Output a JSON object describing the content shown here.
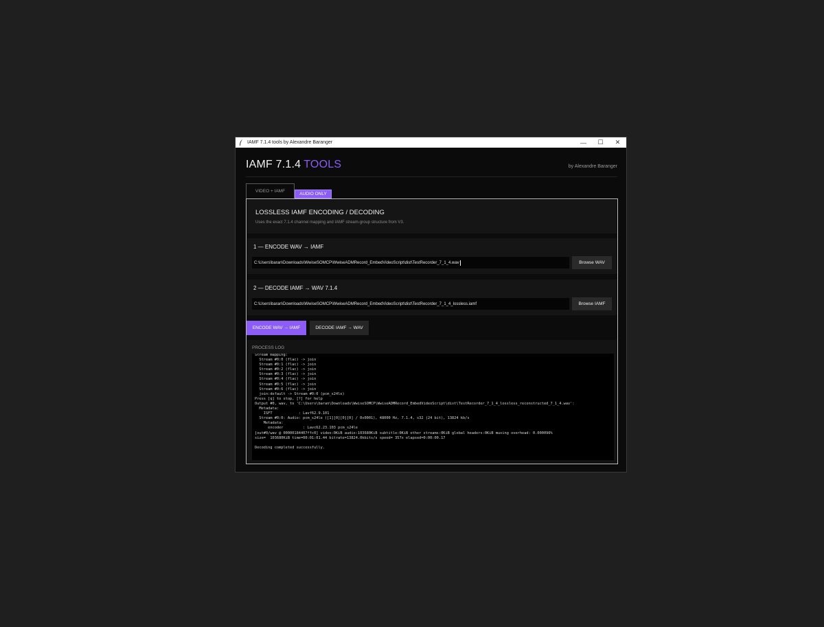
{
  "window": {
    "title": "IAMF 7.1.4 tools by Alexandre Baranger",
    "minimize_glyph": "—",
    "maximize_glyph": "☐",
    "close_glyph": "✕"
  },
  "header": {
    "title_main": "IAMF 7.1.4",
    "title_accent": "TOOLS",
    "author": "by Alexandre Baranger"
  },
  "tabs": {
    "video": "VIDEO + IAMF",
    "audio": "AUDIO ONLY",
    "active": "audio"
  },
  "intro": {
    "title": "LOSSLESS IAMF ENCODING / DECODING",
    "description": "Uses the exact 7.1.4 channel mapping and IAMF stream-group structure from V3."
  },
  "encode": {
    "title": "1 — ENCODE WAV → IAMF",
    "path": "C:\\Users\\baran\\Downloads\\WwiseSOMCP\\WwiseADMRecord_EmbedVideoScript\\dist\\TestRecorder_7_1_4.wav",
    "browse_label": "Browse WAV"
  },
  "decode": {
    "title": "2 — DECODE IAMF → WAV 7.1.4",
    "path": "C:\\Users\\baran\\Downloads\\WwiseSOMCP\\WwiseADMRecord_EmbedVideoScript\\dist\\TestRecorder_7_1_4_lossless.iamf",
    "browse_label": "Browse IAMF"
  },
  "actions": {
    "encode_label": "ENCODE WAV → IAMF",
    "decode_label": "DECODE IAMF → WAV"
  },
  "log": {
    "label": "PROCESS LOG",
    "text": "Stream mapping:\n  Stream #0:0 (flac) -> join\n  Stream #0:1 (flac) -> join\n  Stream #0:2 (flac) -> join\n  Stream #0:3 (flac) -> join\n  Stream #0:4 (flac) -> join\n  Stream #0:5 (flac) -> join\n  Stream #0:6 (flac) -> join\n  join:default -> Stream #0:0 (pcm_s24le)\nPress [q] to stop, [?] for help\nOutput #0, wav, to 'C:\\Users\\baran\\Downloads\\WwiseSOMCP\\WwiseADMRecord_EmbedVideoScript\\dist\\TestRecorder_7_1_4_lossless_reconstructed_7_1_4.wav':\n  Metadata:\n    ISFT            : Lavf62.9.101\n  Stream #0:0: Audio: pcm_s24le ([1][0][0][0] / 0x0001), 48000 Hz, 7.1.4, s32 (24 bit), 13824 kb/s\n    Metadata:\n      encoder         : Lavc62.23.103 pcm_s24le\n[out#0/wav @ 00000184407ffc0] video:0KiB audio:103680KiB subtitle:0KiB other streams:0KiB global headers:0KiB muxing overhead: 0.000096%\nsize=  103680KiB time=00:01:01.44 bitrate=13824.0kbits/s speed= 357x elapsed=0:00:00.17\n\nDecoding completed successfully."
  },
  "colors": {
    "accent": "#8b5cf6",
    "background": "#0b0b0b",
    "card": "#151515"
  }
}
